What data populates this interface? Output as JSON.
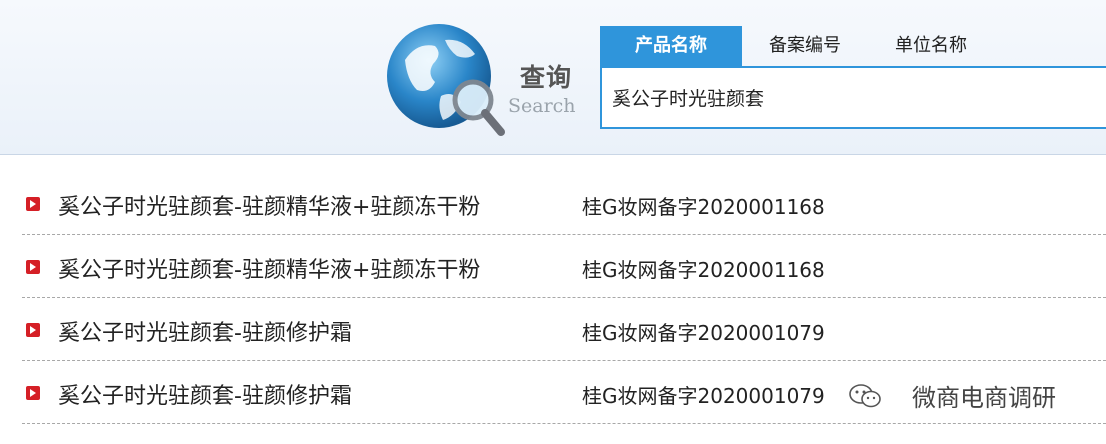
{
  "header": {
    "search_title": "查询",
    "search_sub": "Search",
    "tabs": [
      {
        "label": "产品名称",
        "active": true
      },
      {
        "label": "备案编号",
        "active": false
      },
      {
        "label": "单位名称",
        "active": false
      }
    ],
    "search_value": "奚公子时光驻颜套"
  },
  "results": [
    {
      "name": "奚公子时光驻颜套-驻颜精华液+驻颜冻干粉",
      "code": "桂G妆网备字2020001168"
    },
    {
      "name": "奚公子时光驻颜套-驻颜精华液+驻颜冻干粉",
      "code": "桂G妆网备字2020001168"
    },
    {
      "name": "奚公子时光驻颜套-驻颜修护霜",
      "code": "桂G妆网备字2020001079"
    },
    {
      "name": "奚公子时光驻颜套-驻颜修护霜",
      "code": "桂G妆网备字2020001079"
    }
  ],
  "watermark": {
    "text": "微商电商调研"
  },
  "colors": {
    "accent": "#2f95db",
    "row_icon": "#d51f26"
  }
}
